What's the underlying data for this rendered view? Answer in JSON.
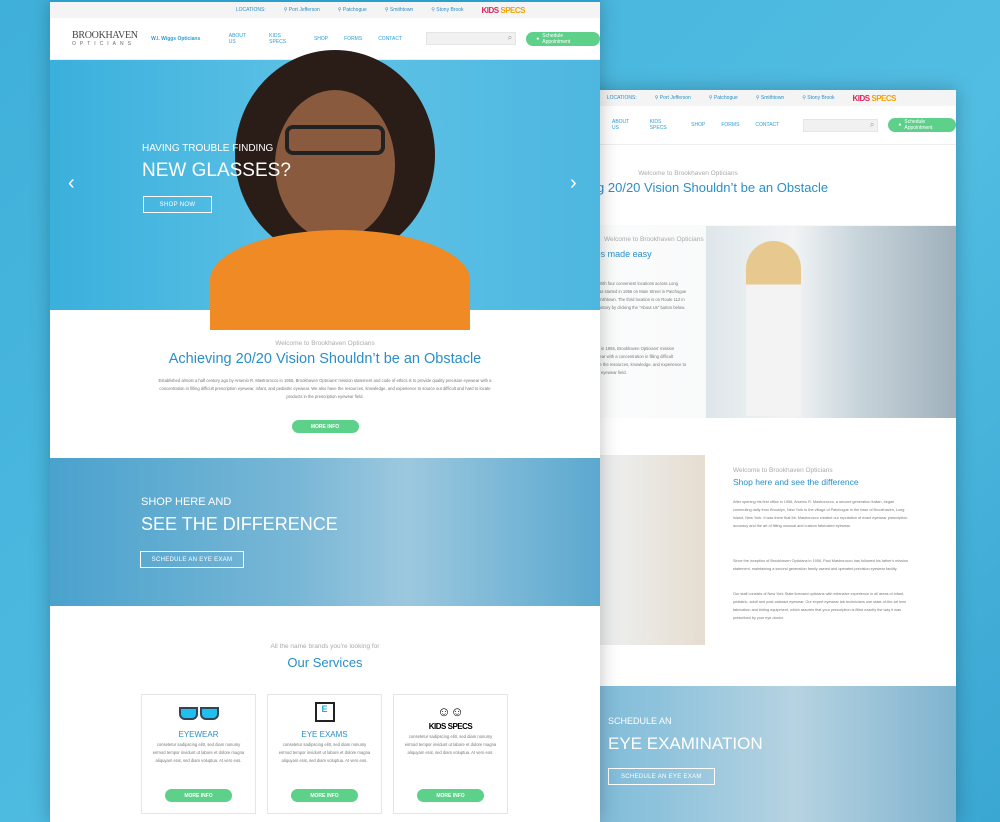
{
  "header": {
    "locations_label": "LOCATIONS:",
    "locations": [
      "Port Jefferson",
      "Patchogue",
      "Smithtown",
      "Stony Brook"
    ],
    "kids_specs": [
      "KIDS",
      " SPECS"
    ],
    "logo_main": "BROOKHAVEN",
    "logo_sub": "OPTICIANS",
    "logo_partner": "W.I. Wiggs Opticians",
    "nav": [
      "ABOUT US",
      "KIDS SPECS",
      "SHOP",
      "FORMS",
      "CONTACT"
    ],
    "schedule_label": "Schedule Appointment",
    "search_icon": "search-icon"
  },
  "hero": {
    "line1": "HAVING TROUBLE FINDING",
    "line2": "NEW GLASSES?",
    "button": "SHOP NOW"
  },
  "welcome": {
    "kicker": "Welcome to Brookhaven Opticians",
    "title": "Achieving 20/20 Vision Shouldn’t be an Obstacle",
    "body": "Established almost a half century ago by Arsenio R. Mastrorocco in 1955, Brookhaven Opticians' mission statement and code of ethics is to provide quality precision eyewear with a concentration in filling difficult prescription eyewear, infant, and pediatric eyewear. We also have the resources, knowledge, and experience to source out difficult and hard to locate products in the prescription eyewear field.",
    "button": "MORE INFO"
  },
  "difference": {
    "line1": "SHOP HERE AND",
    "line2": "SEE THE DIFFERENCE",
    "button": "SCHEDULE AN EYE EXAM"
  },
  "services": {
    "kicker": "All the name brands you're looking for",
    "title": "Our Services",
    "cards": [
      {
        "title": "EYEWEAR",
        "text": "consetetur sadipscing elitr, sed diam nonumy eirmod tempor invidunt ut labore et dolore magna aliquyam erat, sed diam voluptua. At vero eos.",
        "button": "MORE INFO"
      },
      {
        "title": "EYE EXAMS",
        "text": "consetetur sadipscing elitr, sed diam nonumy eirmod tempor invidunt ut labore et dolore magna aliquyam erat, sed diam voluptua. At vero eos.",
        "button": "MORE INFO"
      },
      {
        "title": "KIDS SPECS",
        "text": "consetetur sadipscing elitr, sed diam nonumy eirmod tempor invidunt ut labore et dolore magna aliquyam erat, sed diam voluptua. At vero eos.",
        "button": "MORE INFO"
      }
    ]
  },
  "about": {
    "kicker": "Welcome to Brookhaven Opticians",
    "title": "Finding the right pair of glasses made easy",
    "p1": "Brookhaven Opticians offers the very best in eye care services. With four convenient locations across Long Island, Brookhaven Opticians is family owned and operated. It was started in 1956 on Main Street in Patchogue and opened its second location in 1957 on East Main Street in Smithtown. The third location is on Route 112 in Port Jefferson Station. Read more about Brookhaven Opticians history by clicking the \"About Us\" button below.",
    "p2": "Established almost a half century ago by Arsenio R. Mastrorocco in 1955, Brookhaven Opticians' mission statement and code of ethics is to provide quality precision eyewear with a concentration in filling difficult prescription eyewear, infant, and pediatric eyewear. We also have the resources, knowledge, and experience to source out difficult and hard to locate products in the prescription eyewear field."
  },
  "shop_here": {
    "kicker": "Welcome to Brookhaven Opticians",
    "title": "Shop here and see the difference",
    "p1": "After opening his first office in 1956, Arsenio R. Mastrorocco, a second generation Italian, began commuting daily from Brooklyn, New York to the village of Patchogue in the town of Brookhaven, Long Island, New York. It was there that Mr. Mastrorocco created our reputation of exact eyewear prescription accuracy and the art of fitting unusual and custom fabricated eyewear.",
    "p2": "Since the inception of Brookhaven Opticians in 1956, Paul Mastrorocco has followed his father's mission statement, maintaining a second generation family owned and operated precision eyewear facility.",
    "p3": "Our staff consists of New York State licensed opticians with extensive experience in all areas of infant, pediatric, adult and post-cataract eyewear. Our expert eyewear lab technicians use state-of-the-art lens fabrication and tinting equipment, which assures that your prescription is filled exactly the way it was prescribed by your eye doctor."
  },
  "exam_banner": {
    "line1": "SCHEDULE AN",
    "line2": "EYE EXAMINATION",
    "button": "SCHEDULE AN EYE EXAM"
  }
}
